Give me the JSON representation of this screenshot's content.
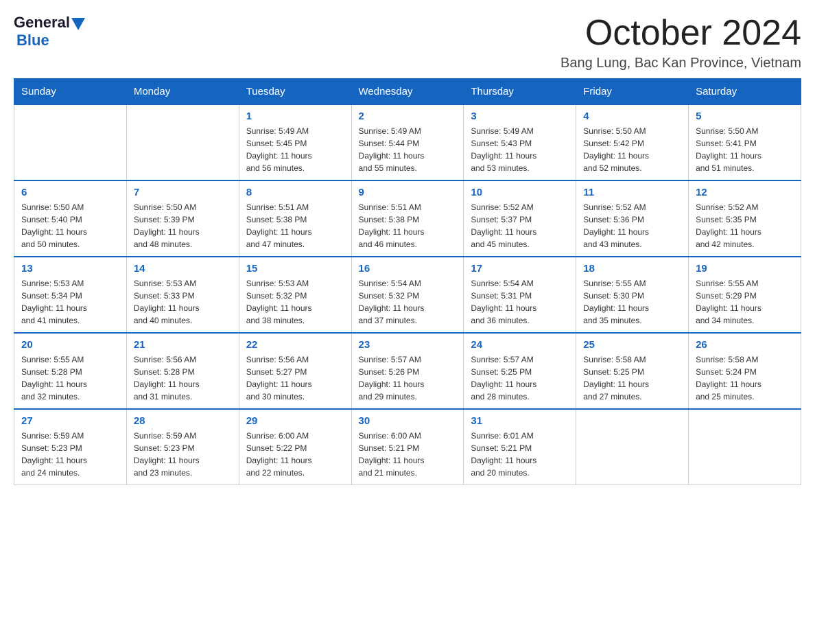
{
  "logo": {
    "general": "General",
    "blue": "Blue"
  },
  "title": "October 2024",
  "location": "Bang Lung, Bac Kan Province, Vietnam",
  "days_of_week": [
    "Sunday",
    "Monday",
    "Tuesday",
    "Wednesday",
    "Thursday",
    "Friday",
    "Saturday"
  ],
  "weeks": [
    [
      {
        "day": "",
        "info": ""
      },
      {
        "day": "",
        "info": ""
      },
      {
        "day": "1",
        "info": "Sunrise: 5:49 AM\nSunset: 5:45 PM\nDaylight: 11 hours\nand 56 minutes."
      },
      {
        "day": "2",
        "info": "Sunrise: 5:49 AM\nSunset: 5:44 PM\nDaylight: 11 hours\nand 55 minutes."
      },
      {
        "day": "3",
        "info": "Sunrise: 5:49 AM\nSunset: 5:43 PM\nDaylight: 11 hours\nand 53 minutes."
      },
      {
        "day": "4",
        "info": "Sunrise: 5:50 AM\nSunset: 5:42 PM\nDaylight: 11 hours\nand 52 minutes."
      },
      {
        "day": "5",
        "info": "Sunrise: 5:50 AM\nSunset: 5:41 PM\nDaylight: 11 hours\nand 51 minutes."
      }
    ],
    [
      {
        "day": "6",
        "info": "Sunrise: 5:50 AM\nSunset: 5:40 PM\nDaylight: 11 hours\nand 50 minutes."
      },
      {
        "day": "7",
        "info": "Sunrise: 5:50 AM\nSunset: 5:39 PM\nDaylight: 11 hours\nand 48 minutes."
      },
      {
        "day": "8",
        "info": "Sunrise: 5:51 AM\nSunset: 5:38 PM\nDaylight: 11 hours\nand 47 minutes."
      },
      {
        "day": "9",
        "info": "Sunrise: 5:51 AM\nSunset: 5:38 PM\nDaylight: 11 hours\nand 46 minutes."
      },
      {
        "day": "10",
        "info": "Sunrise: 5:52 AM\nSunset: 5:37 PM\nDaylight: 11 hours\nand 45 minutes."
      },
      {
        "day": "11",
        "info": "Sunrise: 5:52 AM\nSunset: 5:36 PM\nDaylight: 11 hours\nand 43 minutes."
      },
      {
        "day": "12",
        "info": "Sunrise: 5:52 AM\nSunset: 5:35 PM\nDaylight: 11 hours\nand 42 minutes."
      }
    ],
    [
      {
        "day": "13",
        "info": "Sunrise: 5:53 AM\nSunset: 5:34 PM\nDaylight: 11 hours\nand 41 minutes."
      },
      {
        "day": "14",
        "info": "Sunrise: 5:53 AM\nSunset: 5:33 PM\nDaylight: 11 hours\nand 40 minutes."
      },
      {
        "day": "15",
        "info": "Sunrise: 5:53 AM\nSunset: 5:32 PM\nDaylight: 11 hours\nand 38 minutes."
      },
      {
        "day": "16",
        "info": "Sunrise: 5:54 AM\nSunset: 5:32 PM\nDaylight: 11 hours\nand 37 minutes."
      },
      {
        "day": "17",
        "info": "Sunrise: 5:54 AM\nSunset: 5:31 PM\nDaylight: 11 hours\nand 36 minutes."
      },
      {
        "day": "18",
        "info": "Sunrise: 5:55 AM\nSunset: 5:30 PM\nDaylight: 11 hours\nand 35 minutes."
      },
      {
        "day": "19",
        "info": "Sunrise: 5:55 AM\nSunset: 5:29 PM\nDaylight: 11 hours\nand 34 minutes."
      }
    ],
    [
      {
        "day": "20",
        "info": "Sunrise: 5:55 AM\nSunset: 5:28 PM\nDaylight: 11 hours\nand 32 minutes."
      },
      {
        "day": "21",
        "info": "Sunrise: 5:56 AM\nSunset: 5:28 PM\nDaylight: 11 hours\nand 31 minutes."
      },
      {
        "day": "22",
        "info": "Sunrise: 5:56 AM\nSunset: 5:27 PM\nDaylight: 11 hours\nand 30 minutes."
      },
      {
        "day": "23",
        "info": "Sunrise: 5:57 AM\nSunset: 5:26 PM\nDaylight: 11 hours\nand 29 minutes."
      },
      {
        "day": "24",
        "info": "Sunrise: 5:57 AM\nSunset: 5:25 PM\nDaylight: 11 hours\nand 28 minutes."
      },
      {
        "day": "25",
        "info": "Sunrise: 5:58 AM\nSunset: 5:25 PM\nDaylight: 11 hours\nand 27 minutes."
      },
      {
        "day": "26",
        "info": "Sunrise: 5:58 AM\nSunset: 5:24 PM\nDaylight: 11 hours\nand 25 minutes."
      }
    ],
    [
      {
        "day": "27",
        "info": "Sunrise: 5:59 AM\nSunset: 5:23 PM\nDaylight: 11 hours\nand 24 minutes."
      },
      {
        "day": "28",
        "info": "Sunrise: 5:59 AM\nSunset: 5:23 PM\nDaylight: 11 hours\nand 23 minutes."
      },
      {
        "day": "29",
        "info": "Sunrise: 6:00 AM\nSunset: 5:22 PM\nDaylight: 11 hours\nand 22 minutes."
      },
      {
        "day": "30",
        "info": "Sunrise: 6:00 AM\nSunset: 5:21 PM\nDaylight: 11 hours\nand 21 minutes."
      },
      {
        "day": "31",
        "info": "Sunrise: 6:01 AM\nSunset: 5:21 PM\nDaylight: 11 hours\nand 20 minutes."
      },
      {
        "day": "",
        "info": ""
      },
      {
        "day": "",
        "info": ""
      }
    ]
  ]
}
